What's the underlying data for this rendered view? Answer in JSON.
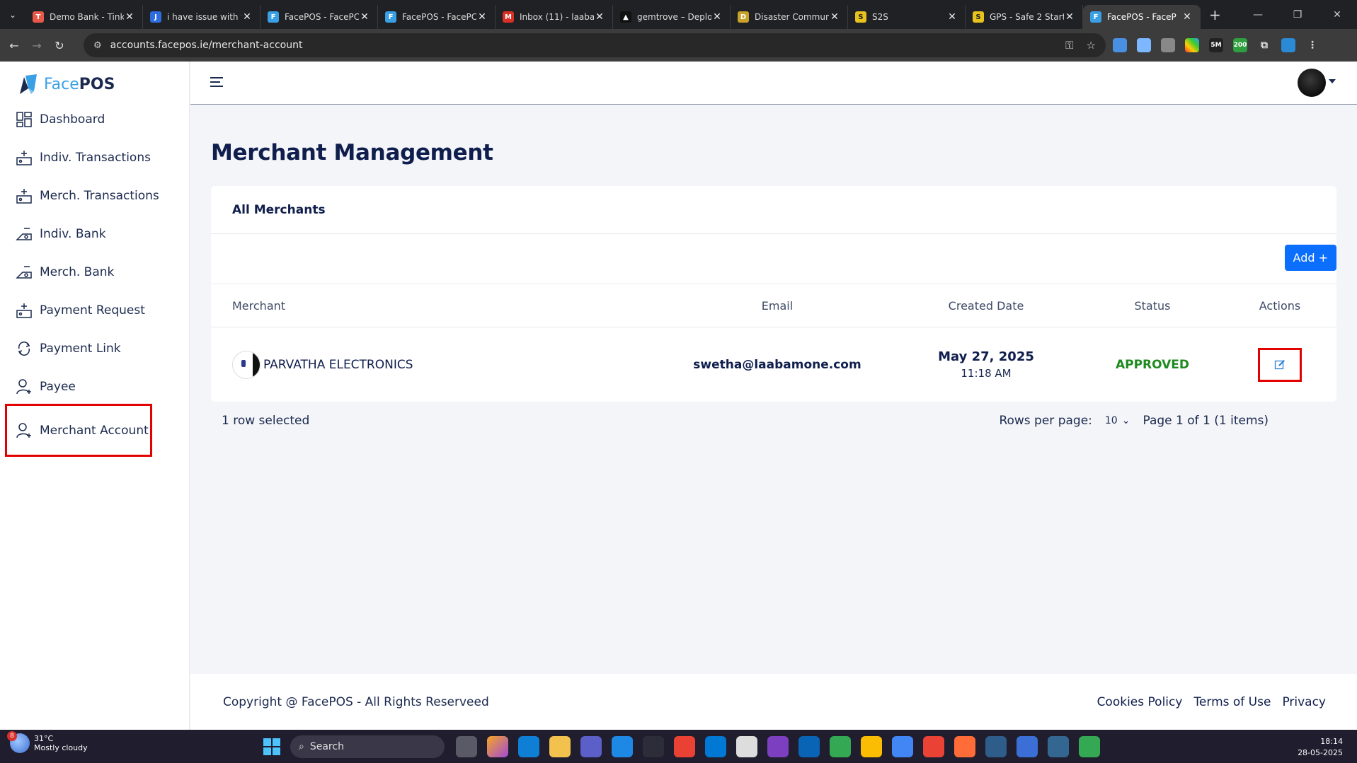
{
  "browser": {
    "tabs": [
      {
        "title": "Demo Bank - Tink",
        "color": "#e8594a"
      },
      {
        "title": "i have issue with t",
        "color": "#2d6de0"
      },
      {
        "title": "FacePOS - FacePC",
        "color": "#3aa0e6"
      },
      {
        "title": "FacePOS - FacePC",
        "color": "#3aa0e6"
      },
      {
        "title": "Inbox (11) - laaba",
        "color": "#d93025"
      },
      {
        "title": "gemtrove – Deplo",
        "color": "#111111"
      },
      {
        "title": "Disaster Commun",
        "color": "#c9a227"
      },
      {
        "title": "S2S",
        "color": "#e8c21d"
      },
      {
        "title": "GPS - Safe 2 Start",
        "color": "#e8c21d"
      },
      {
        "title": "FacePOS - FaceP",
        "color": "#3aa0e6",
        "active": true
      }
    ],
    "url": "accounts.facepos.ie/merchant-account"
  },
  "brand": {
    "face": "Face",
    "pos": "POS"
  },
  "sidebar": {
    "items": [
      {
        "label": "Dashboard",
        "icon": "dashboard-icon"
      },
      {
        "label": "Indiv. Transactions",
        "icon": "transactions-icon"
      },
      {
        "label": "Merch. Transactions",
        "icon": "transactions-icon"
      },
      {
        "label": "Indiv. Bank",
        "icon": "bank-icon"
      },
      {
        "label": "Merch. Bank",
        "icon": "bank-icon"
      },
      {
        "label": "Payment Request",
        "icon": "transactions-icon"
      },
      {
        "label": "Payment Link",
        "icon": "link-icon"
      },
      {
        "label": "Payee",
        "icon": "user-plus-icon"
      },
      {
        "label": "Merchant Account",
        "icon": "user-plus-icon",
        "highlighted": true
      }
    ]
  },
  "page": {
    "title": "Merchant Management"
  },
  "card": {
    "title": "All Merchants",
    "add_label": "Add +",
    "columns": {
      "merchant": "Merchant",
      "email": "Email",
      "created": "Created Date",
      "status": "Status",
      "actions": "Actions"
    },
    "rows": [
      {
        "merchant": "PARVATHA ELECTRONICS",
        "email": "swetha@laabamone.com",
        "date": "May 27, 2025",
        "time": "11:18 AM",
        "status": "APPROVED"
      }
    ]
  },
  "table_footer": {
    "selected": "1 row selected",
    "rows_per_page_label": "Rows per page:",
    "rows_per_page_value": "10",
    "page_info": "Page 1 of 1 (1 items)"
  },
  "footer": {
    "copyright": "Copyright @ FacePOS - All Rights Reserveed",
    "links": [
      "Cookies Policy",
      "Terms of Use",
      "Privacy"
    ]
  },
  "taskbar": {
    "weather_temp": "31°C",
    "weather_desc": "Mostly cloudy",
    "weather_badge": "8",
    "search_placeholder": "Search",
    "time": "18:14",
    "date": "28-05-2025"
  },
  "colors": {
    "accent": "#0c6efd",
    "approved": "#1f8a1f",
    "highlight": "#e30000",
    "navy": "#0f1e4d"
  }
}
